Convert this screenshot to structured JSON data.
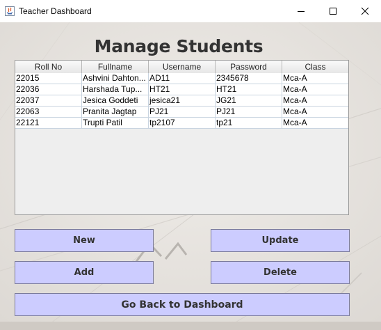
{
  "window": {
    "title": "Teacher Dashboard"
  },
  "page": {
    "title": "Manage Students"
  },
  "table": {
    "columns": [
      "Roll No",
      "Fullname",
      "Username",
      "Password",
      "Class"
    ],
    "rows": [
      [
        "22015",
        "Ashvini Dahton...",
        "AD11",
        "2345678",
        "Mca-A"
      ],
      [
        "22036",
        "Harshada Tup...",
        "HT21",
        "HT21",
        "Mca-A"
      ],
      [
        "22037",
        "Jesica Goddeti",
        "jesica21",
        "JG21",
        "Mca-A"
      ],
      [
        "22063",
        "Pranita Jagtap",
        "PJ21",
        "PJ21",
        "Mca-A"
      ],
      [
        "22121",
        "Trupti Patil",
        "tp2107",
        "tp21",
        "Mca-A"
      ]
    ]
  },
  "buttons": {
    "new": "New",
    "update": "Update",
    "add": "Add",
    "delete": "Delete",
    "back": "Go Back to Dashboard"
  },
  "colors": {
    "button_bg": "#ccccff",
    "content_bg": "#e9e6e2",
    "title_text": "#333333"
  }
}
